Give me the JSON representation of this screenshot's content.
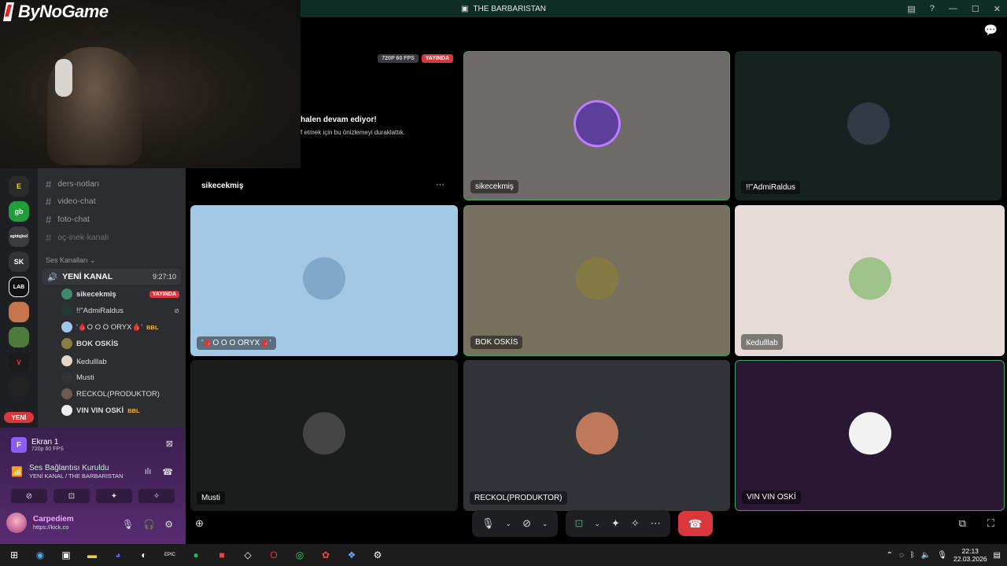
{
  "window": {
    "title": "THE BARBARISTAN"
  },
  "overlay": {
    "logo": "ByNoGame"
  },
  "stream": {
    "quality_badge": "720P 60 FPS",
    "live_badge": "YAYINDA",
    "paused_title": "halen devam ediyor!",
    "paused_sub": "f etmek için bu önizlemeyi duraklattık.",
    "streamer": "sikecekmiş",
    "more": "···"
  },
  "sidebar": {
    "channels": [
      {
        "label": "ders-notları"
      },
      {
        "label": "video-chat"
      },
      {
        "label": "foto-chat"
      },
      {
        "label": "oç-inek-kanalı"
      }
    ],
    "voice_section": "Ses Kanalları",
    "voice_channel": {
      "name": "YENİ KANAL",
      "time": "9:27:10"
    },
    "voice_users": [
      {
        "name": "sikecekmiş",
        "badge": "YAYINDA",
        "color": "#3b8a6b"
      },
      {
        "name": "!!\"AdmiRaldus",
        "color": "#1f3a34"
      },
      {
        "name": "'🩸O O O ORYX🩸'",
        "tag": "BBL",
        "color": "#9fc6e8"
      },
      {
        "name": "BOK OSKİS",
        "color": "#8a7d44"
      },
      {
        "name": "Ꝃedulllab",
        "color": "#e6d6c4"
      },
      {
        "name": "Musti",
        "color": "#333"
      },
      {
        "name": "RECKOL(PRODUKTOR)",
        "color": "#6b5a4d"
      },
      {
        "name": "VIN VIN OSKİ",
        "tag": "BBL",
        "color": "#eee"
      }
    ],
    "servers": [
      {
        "label": "E",
        "color": "#2a2a2a"
      },
      {
        "label": "gb",
        "color": "#1f9d3a"
      },
      {
        "label": "agtdqjied",
        "color": "#3a3b40"
      },
      {
        "label": "SK",
        "color": "#313338"
      },
      {
        "label": "LAB",
        "color": "#111"
      }
    ],
    "new_badge": "YENİ"
  },
  "panel": {
    "screen": "Ekran 1",
    "screen_sub": "720p 60 FPS",
    "connection": "Ses Bağlantısı Kuruldu",
    "connection_sub": "YENİ KANAL / THE BARBARISTAN",
    "username": "Carpediem",
    "status": "https://kick.co"
  },
  "tiles": [
    {
      "name": "sikecekmiş",
      "bg": "#6d6a67",
      "avatar": "#5b3f9a"
    },
    {
      "name": "!!\"AdmiRaldus",
      "bg": "#16221f",
      "avatar": "#2f3a44"
    },
    {
      "name": "'🩸O O O ORYX🩸'",
      "bg": "#a3c8e6",
      "avatar": "#7fa8c9"
    },
    {
      "name": "BOK OSKİS",
      "bg": "#77705f",
      "avatar": "#867a44"
    },
    {
      "name": "Ꝃedulllab",
      "bg": "#e6dbd6",
      "avatar": "#9ec48c"
    },
    {
      "name": "Musti",
      "bg": "#1b1c1c",
      "avatar": "#444"
    },
    {
      "name": "RECKOL(PRODUKTOR)",
      "bg": "#313338",
      "avatar": "#c0785a"
    },
    {
      "name": "VIN VIN OSKİ",
      "bg": "#2a1734",
      "avatar": "#f2f2f2"
    }
  ],
  "taskbar": {
    "time": "22:13",
    "date": "22.03.2026"
  }
}
